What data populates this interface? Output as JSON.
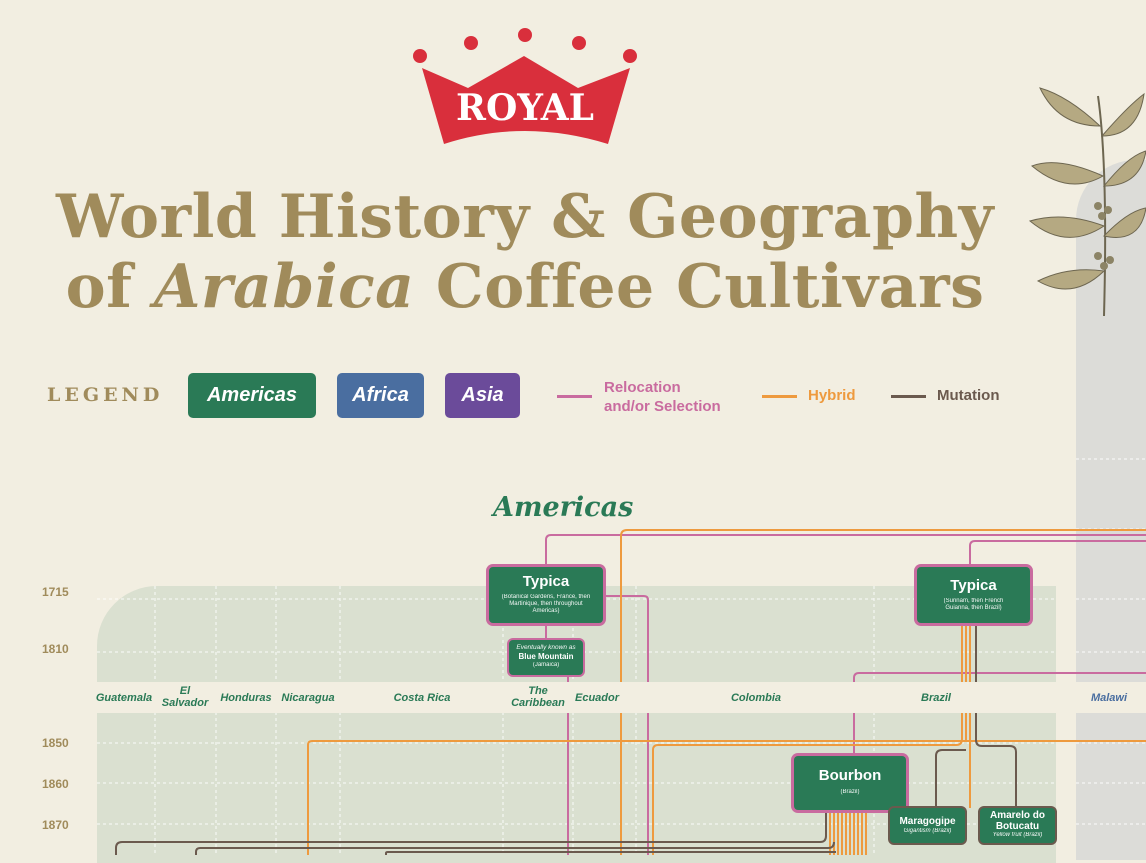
{
  "brand": {
    "logo_text": "ROYAL",
    "crown_color": "#d92f3c"
  },
  "title": {
    "line1": "World History & Geography",
    "line2_pre": "of ",
    "line2_em": "Arabica",
    "line2_post": " Coffee Cultivars",
    "color": "#a08b5b"
  },
  "legend": {
    "label": "LEGEND",
    "regions": [
      {
        "label": "Americas",
        "color": "#2a7a56"
      },
      {
        "label": "Africa",
        "color": "#4a6ea0"
      },
      {
        "label": "Asia",
        "color": "#6b4b9a"
      }
    ],
    "lines": [
      {
        "label_line1": "Relocation",
        "label_line2": "and/or Selection",
        "color": "#c96b9f"
      },
      {
        "label": "Hybrid",
        "color": "#ee9a3e"
      },
      {
        "label": "Mutation",
        "color": "#6b5a4e"
      }
    ]
  },
  "section": {
    "title": "Americas"
  },
  "years": [
    "1715",
    "1810",
    "1850",
    "1860",
    "1870"
  ],
  "countries": [
    "Guatemala",
    "El Salvador",
    "Honduras",
    "Nicaragua",
    "Costa Rica",
    "The Caribbean",
    "Ecuador",
    "Colombia",
    "Brazil",
    "Malawi"
  ],
  "nodes": {
    "typica1": {
      "name": "Typica",
      "sub": "(Botanical Gardens, France, then Martinique, then throughout Americas)"
    },
    "typica2": {
      "name": "Typica",
      "sub": "(Surinam, then French Guianna, then Brazil)"
    },
    "blue": {
      "pre": "Eventually known as",
      "name": "Blue Mountain",
      "sub": "(Jamaica)"
    },
    "bourbon": {
      "name": "Bourbon",
      "sub": "(Brazil)"
    },
    "maragogipe": {
      "name": "Maragogipe",
      "sub": "Gigantism (Brazil)"
    },
    "amarelo": {
      "name": "Amarelo do Botucatu",
      "sub": "Yellow fruit (Brazil)"
    }
  }
}
